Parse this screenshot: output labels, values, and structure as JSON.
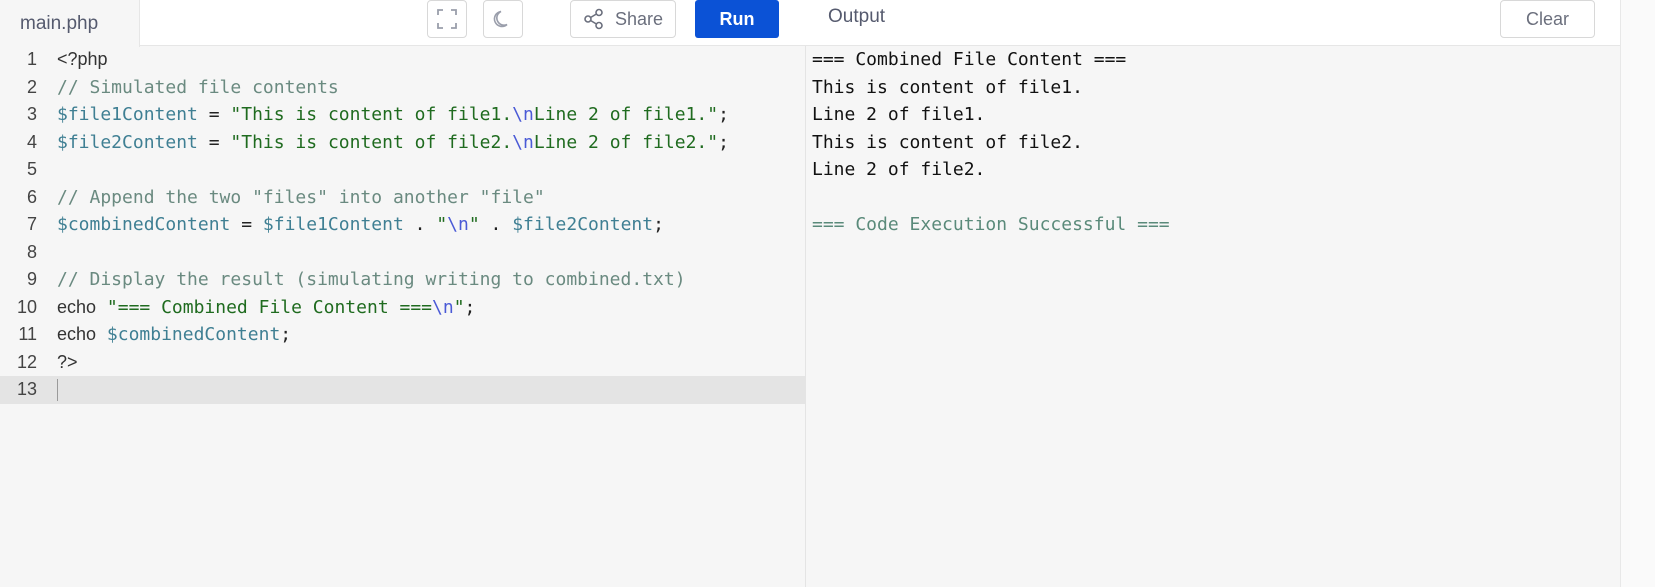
{
  "editor": {
    "file_tab": "main.php",
    "toolbar": {
      "fullscreen_icon": "fullscreen-icon",
      "theme_icon": "moon-icon",
      "share_label": "Share",
      "run_label": "Run"
    },
    "lines": [
      {
        "num": "1",
        "tokens": [
          {
            "t": "kw",
            "v": "<?php"
          }
        ]
      },
      {
        "num": "2",
        "tokens": [
          {
            "t": "cm",
            "v": "// Simulated file contents"
          }
        ]
      },
      {
        "num": "3",
        "tokens": [
          {
            "t": "var",
            "v": "$file1Content"
          },
          {
            "t": "op",
            "v": " = "
          },
          {
            "t": "str",
            "v": "\"This is content of file1."
          },
          {
            "t": "esc",
            "v": "\\n"
          },
          {
            "t": "str",
            "v": "Line 2 of file1.\""
          },
          {
            "t": "op",
            "v": ";"
          }
        ]
      },
      {
        "num": "4",
        "tokens": [
          {
            "t": "var",
            "v": "$file2Content"
          },
          {
            "t": "op",
            "v": " = "
          },
          {
            "t": "str",
            "v": "\"This is content of file2."
          },
          {
            "t": "esc",
            "v": "\\n"
          },
          {
            "t": "str",
            "v": "Line 2 of file2.\""
          },
          {
            "t": "op",
            "v": ";"
          }
        ]
      },
      {
        "num": "5",
        "tokens": []
      },
      {
        "num": "6",
        "tokens": [
          {
            "t": "cm",
            "v": "// Append the two \"files\" into another \"file\""
          }
        ]
      },
      {
        "num": "7",
        "tokens": [
          {
            "t": "var",
            "v": "$combinedContent"
          },
          {
            "t": "op",
            "v": " = "
          },
          {
            "t": "var",
            "v": "$file1Content"
          },
          {
            "t": "op",
            "v": " . "
          },
          {
            "t": "str",
            "v": "\""
          },
          {
            "t": "esc",
            "v": "\\n"
          },
          {
            "t": "str",
            "v": "\""
          },
          {
            "t": "op",
            "v": " . "
          },
          {
            "t": "var",
            "v": "$file2Content"
          },
          {
            "t": "op",
            "v": ";"
          }
        ]
      },
      {
        "num": "8",
        "tokens": []
      },
      {
        "num": "9",
        "tokens": [
          {
            "t": "cm",
            "v": "// Display the result (simulating writing to combined.txt)"
          }
        ]
      },
      {
        "num": "10",
        "tokens": [
          {
            "t": "kw",
            "v": "echo"
          },
          {
            "t": "op",
            "v": " "
          },
          {
            "t": "str",
            "v": "\"=== Combined File Content ==="
          },
          {
            "t": "esc",
            "v": "\\n"
          },
          {
            "t": "str",
            "v": "\""
          },
          {
            "t": "op",
            "v": ";"
          }
        ]
      },
      {
        "num": "11",
        "tokens": [
          {
            "t": "kw",
            "v": "echo"
          },
          {
            "t": "op",
            "v": " "
          },
          {
            "t": "var",
            "v": "$combinedContent"
          },
          {
            "t": "op",
            "v": ";"
          }
        ]
      },
      {
        "num": "12",
        "tokens": [
          {
            "t": "kw",
            "v": "?>"
          }
        ]
      },
      {
        "num": "13",
        "tokens": [],
        "active": true
      }
    ]
  },
  "output": {
    "title": "Output",
    "clear_label": "Clear",
    "lines": [
      {
        "text": "=== Combined File Content ==="
      },
      {
        "text": "This is content of file1."
      },
      {
        "text": "Line 2 of file1."
      },
      {
        "text": "This is content of file2."
      },
      {
        "text": "Line 2 of file2."
      },
      {
        "text": ""
      },
      {
        "text": "=== Code Execution Successful ===",
        "success": true
      }
    ]
  },
  "colors": {
    "run_button": "#0b52d6",
    "comment": "#6a8a80",
    "variable": "#3f7f93",
    "string": "#1f6b1f",
    "escape": "#4a5ad6",
    "success": "#5a8a7a"
  }
}
